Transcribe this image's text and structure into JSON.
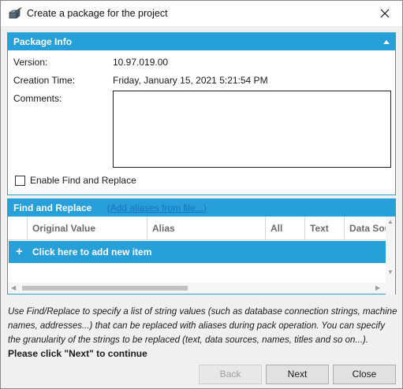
{
  "window": {
    "title": "Create a package for the project",
    "close_label": "✕"
  },
  "package_info": {
    "header": "Package Info",
    "version_label": "Version:",
    "version_value": "10.97.019.00",
    "creation_label": "Creation Time:",
    "creation_value": "Friday, January 15, 2021 5:21:54 PM",
    "comments_label": "Comments:",
    "comments_value": "",
    "enable_find_replace_label": "Enable Find and Replace",
    "enable_find_replace_checked": false
  },
  "find_replace": {
    "header": "Find and Replace",
    "add_aliases_link": "(Add aliases from file...)",
    "columns": [
      "Original Value",
      "Alias",
      "All",
      "Text",
      "Data Sou"
    ],
    "add_item_label": "Click here to add new item",
    "add_item_icon": "+"
  },
  "description": "Use Find/Replace to specify a list of string values (such as database connection strings, machine names, addresses...) that can be replaced with aliases during pack operation. You can specify the granularity of the strings to be replaced (text, data sources, names, titles and so on...).",
  "instruction": "Please click \"Next\" to continue",
  "buttons": {
    "back": "Back",
    "next": "Next",
    "close": "Close"
  },
  "colors": {
    "accent": "#27a0d9",
    "link": "#1e6fc2"
  }
}
